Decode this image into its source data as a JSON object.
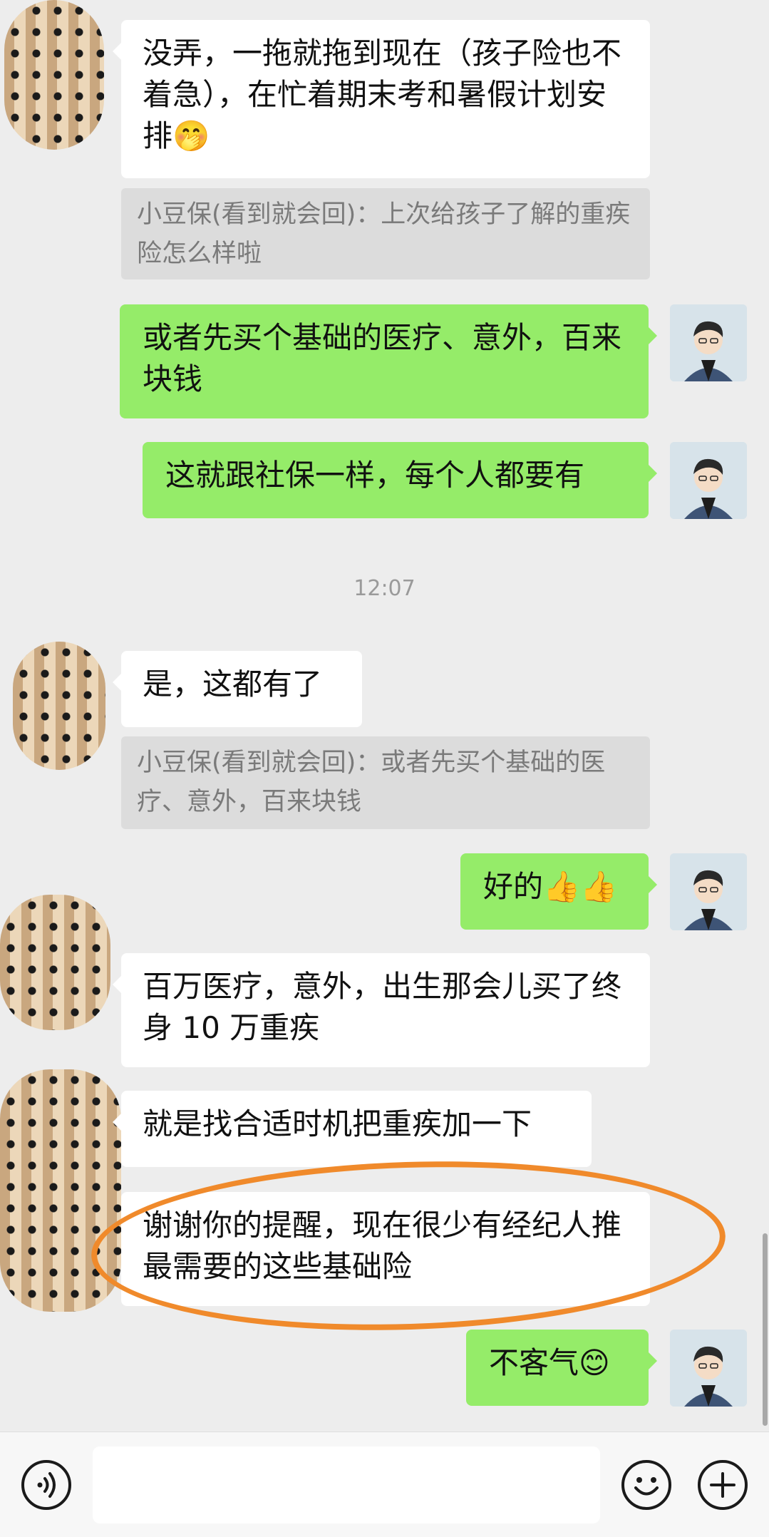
{
  "messages": [
    {
      "side": "in",
      "text": "没弄，一拖就拖到现在（孩子险也不着急），在忙着期末考和暑假计划安排",
      "emoji": "🤭"
    },
    {
      "side": "quote",
      "text": "小豆保(看到就会回)：上次给孩子了解的重疾险怎么样啦"
    },
    {
      "side": "out",
      "text": "或者先买个基础的医疗、意外，百来块钱"
    },
    {
      "side": "out",
      "text": "这就跟社保一样，每个人都要有"
    },
    {
      "side": "time",
      "text": "12:07"
    },
    {
      "side": "in",
      "text": "是，这都有了"
    },
    {
      "side": "quote",
      "text": "小豆保(看到就会回)：或者先买个基础的医疗、意外，百来块钱"
    },
    {
      "side": "out",
      "text": "好的",
      "emoji": "👍👍"
    },
    {
      "side": "in",
      "text": "百万医疗，意外，出生那会儿买了终身 10 万重疾"
    },
    {
      "side": "in",
      "text": "就是找合适时机把重疾加一下"
    },
    {
      "side": "in",
      "text": "谢谢你的提醒，现在很少有经纪人推最需要的这些基础险"
    },
    {
      "side": "out",
      "text": "不客气",
      "emoji": "😊"
    }
  ],
  "icons": {
    "voice": "voice-input-icon",
    "emoji": "emoji-smile-icon",
    "more": "plus-circle-icon"
  },
  "colors": {
    "background": "#ededed",
    "outgoing_bubble": "#95ec69",
    "incoming_bubble": "#ffffff",
    "quote_bubble": "#dcdcdc",
    "highlight_ring": "#f08a2b"
  }
}
